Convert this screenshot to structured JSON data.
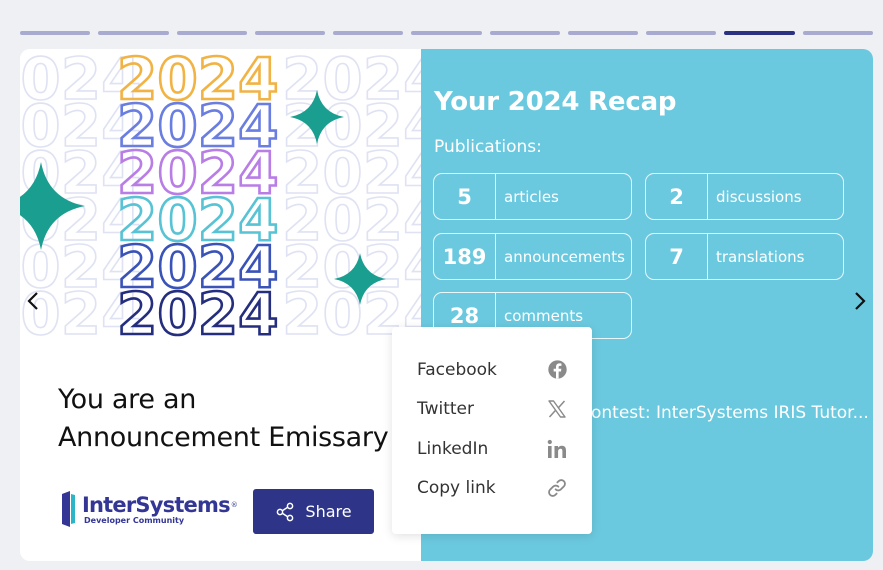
{
  "progress": {
    "segments": 11,
    "active_index": 9
  },
  "art": {
    "year_text": "2024"
  },
  "left": {
    "headline_line1": "You are an",
    "headline_line2": "Announcement Emissary",
    "logo": {
      "brand": "InterSystems",
      "trademark": "®",
      "sub": "Developer Community"
    },
    "share_label": "Share"
  },
  "right": {
    "title": "Your 2024 Recap",
    "publications_label": "Publications:",
    "stats": [
      {
        "value": "5",
        "label": "articles"
      },
      {
        "value": "2",
        "label": "discussions"
      },
      {
        "value": "189",
        "label": "announcements"
      },
      {
        "value": "7",
        "label": "translations"
      },
      {
        "value": "28",
        "label": "comments"
      }
    ],
    "contest_text": "ontest: InterSystems IRIS Tutor..."
  },
  "share_menu": {
    "items": [
      {
        "label": "Facebook",
        "icon": "facebook-icon"
      },
      {
        "label": "Twitter",
        "icon": "x-twitter-icon"
      },
      {
        "label": "LinkedIn",
        "icon": "linkedin-icon"
      },
      {
        "label": "Copy link",
        "icon": "link-icon"
      }
    ]
  },
  "colors": {
    "accent_dark": "#2e3589",
    "recap_bg": "#6bc9df",
    "progress_inactive": "#a8abcf",
    "progress_active": "#2a3281",
    "sparkle": "#1a9e8f"
  }
}
